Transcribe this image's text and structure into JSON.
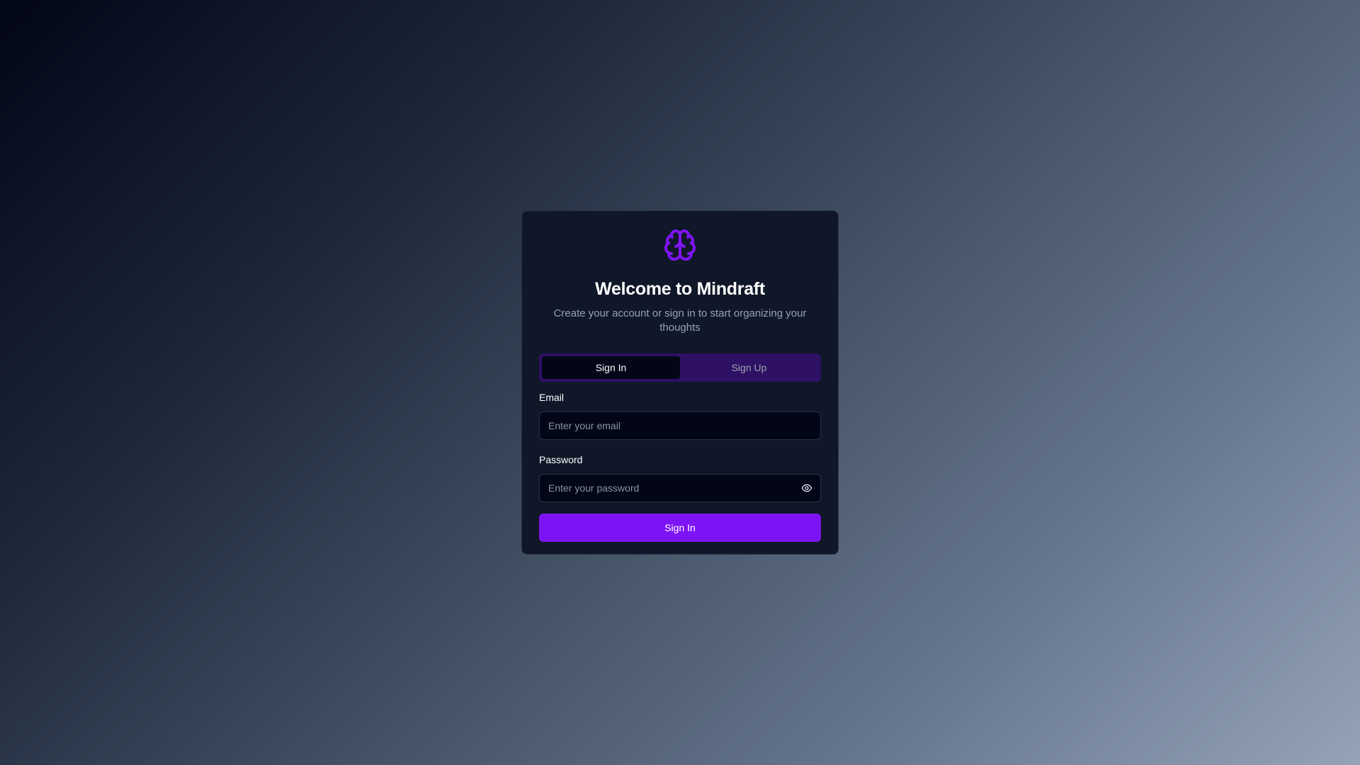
{
  "brand": {
    "logo_icon": "brain-icon",
    "accent_color": "#7e14f5"
  },
  "header": {
    "title": "Welcome to Mindraft",
    "subtitle": "Create your account or sign in to start organizing your thoughts"
  },
  "tabs": [
    {
      "label": "Sign In",
      "active": true
    },
    {
      "label": "Sign Up",
      "active": false
    }
  ],
  "form": {
    "email": {
      "label": "Email",
      "value": "",
      "placeholder": "Enter your email"
    },
    "password": {
      "label": "Password",
      "value": "",
      "placeholder": "Enter your password",
      "toggle_icon": "eye-icon"
    },
    "submit_label": "Sign In"
  }
}
